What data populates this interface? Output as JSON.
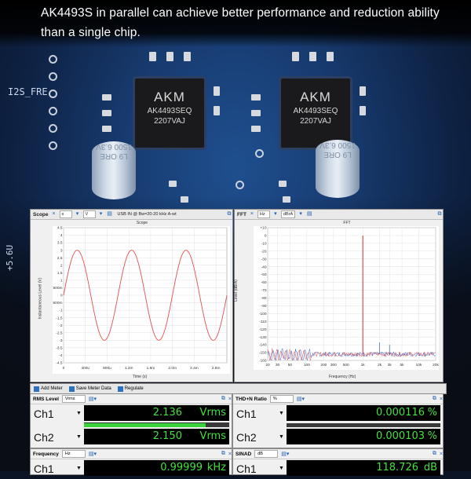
{
  "headline": {
    "line1": "AK4493S in parallel can achieve better performance and reduction ability",
    "line2": "than a single chip."
  },
  "pcb": {
    "label_i2s": "I2S_FRE",
    "label_voltage": "+5.6U",
    "chips": [
      {
        "brand": "AKM",
        "model": "AK4493SEQ",
        "code": "2207VAJ"
      },
      {
        "brand": "AKM",
        "model": "AK4493SEQ",
        "code": "2207VAJ"
      }
    ],
    "caps": [
      {
        "text": "L9 ORE 1500 6.3V"
      },
      {
        "text": "L9 ORE 1500 6.3V"
      }
    ]
  },
  "scope": {
    "name": "Scope",
    "sel1": "s",
    "sel2": "V",
    "status": "USB IN @ Bw=20-20 kHz A-wt",
    "plot_title": "Scope",
    "ylabel": "Instantaneous Level (V)",
    "xlabel": "Time (s)"
  },
  "fft": {
    "name": "FFT",
    "sel1": "Hz",
    "sel2": "dBrA",
    "plot_title": "FFT",
    "ylabel": "Level (dBrA)",
    "xlabel": "Frequency (Hz)"
  },
  "chart_data": [
    {
      "type": "line",
      "title": "Scope",
      "xlabel": "Time (s)",
      "ylabel": "Instantaneous Level (V)",
      "x_ticks": [
        "0",
        "400u",
        "800u",
        "1.2m",
        "1.6m",
        "2.0m",
        "2.4m",
        "2.8m"
      ],
      "y_ticks": [
        "4.5",
        "4",
        "3.5",
        "3",
        "2.5",
        "2",
        "1.5",
        "1",
        "500m",
        "0",
        "-500m",
        "-1",
        "-1.5",
        "-2",
        "-2.5",
        "-3",
        "-3.5",
        "-4",
        "-4.5"
      ],
      "xlim": [
        0,
        0.003
      ],
      "ylim": [
        -4.5,
        4.5
      ],
      "series": [
        {
          "frequency_hz": 1000,
          "amplitude": 3.0,
          "color": "#e05050"
        }
      ],
      "grid": true
    },
    {
      "type": "line",
      "title": "FFT",
      "xlabel": "Frequency (Hz)",
      "ylabel": "Level (dBrA)",
      "x_ticks": [
        "20",
        "30",
        "50",
        "100",
        "200",
        "300",
        "500",
        "1k",
        "2k",
        "3k",
        "5k",
        "10k",
        "20k"
      ],
      "y_ticks": [
        "+10",
        "0",
        "-10",
        "-20",
        "-30",
        "-40",
        "-50",
        "-60",
        "-70",
        "-80",
        "-90",
        "-100",
        "-110",
        "-120",
        "-130",
        "-140",
        "-150",
        "-160"
      ],
      "xlim": [
        20,
        20000
      ],
      "ylim": [
        -160,
        10
      ],
      "x_scale": "log",
      "peaks": [
        {
          "freq": 1000,
          "level": 0
        },
        {
          "freq": 2000,
          "level": -137
        },
        {
          "freq": 3000,
          "level": -140
        }
      ],
      "noise_floor": -152,
      "series_colors": [
        "#2a56c8",
        "#d04040"
      ],
      "grid": true
    }
  ],
  "meter_toolbar": {
    "add_meter": "Add Meter",
    "save_meter_data": "Save Meter Data",
    "regulate": "Regulate"
  },
  "meters": [
    {
      "title": "RMS Level",
      "sel": "Vrms",
      "rows": [
        {
          "ch": "Ch1",
          "value": "2.136",
          "unit": "Vrms",
          "fill": 0.84
        },
        {
          "ch": "Ch2",
          "value": "2.150",
          "unit": "Vrms",
          "fill": 0.84
        }
      ]
    },
    {
      "title": "THD+N Ratio",
      "sel": "%",
      "rows": [
        {
          "ch": "Ch1",
          "value": "0.000116",
          "unit": "%",
          "fill": 0.0
        },
        {
          "ch": "Ch2",
          "value": "0.000103",
          "unit": "%",
          "fill": 0.0
        }
      ]
    },
    {
      "title": "Frequency",
      "sel": "Hz",
      "rows": [
        {
          "ch": "Ch1",
          "value": "0.99999",
          "unit": "kHz",
          "fill": 0
        }
      ]
    },
    {
      "title": "SINAD",
      "sel": "dB",
      "rows": [
        {
          "ch": "Ch1",
          "value": "118.726",
          "unit": "dB",
          "fill": 0
        }
      ]
    }
  ]
}
